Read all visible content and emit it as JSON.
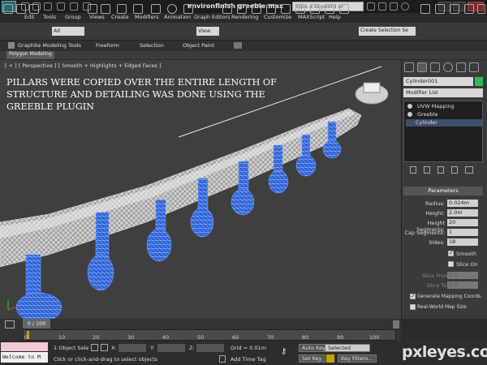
{
  "window": {
    "title": "environfinish greeble.max",
    "search_placeholder": "Type a keyword or phrase"
  },
  "menubar": {
    "items": [
      "Edit",
      "Tools",
      "Group",
      "Views",
      "Create",
      "Modifiers",
      "Animation",
      "Graph Editors",
      "Rendering",
      "Customize",
      "MAXScript",
      "Help"
    ]
  },
  "toolbar": {
    "selection_filter": "All",
    "view_dropdown": "View",
    "named_selection": "Create Selection Se"
  },
  "ribbon": {
    "tabs": [
      "Graphite Modeling Tools",
      "Freeform",
      "Selection",
      "Object Paint"
    ],
    "subtab": "Polygon Modeling"
  },
  "viewport": {
    "label": "[ + ] [ Perspective ] [ Smooth + Highlights + Edged Faces ]",
    "annotation": "PILLARS WERE COPIED OVER THE ENTIRE LENGTH OF STRUCTURE AND DETAILING WAS DONE USING THE GREEBLE PLUGIN"
  },
  "command_panel": {
    "object_name": "Cylinder001",
    "object_color": "#2fbf4f",
    "modifier_list": "Modifier List",
    "stack": [
      "UVW Mapping",
      "Greeble",
      "Cylinder"
    ],
    "parameters_title": "Parameters",
    "params": [
      {
        "label": "Radius:",
        "value": "0.024m"
      },
      {
        "label": "Height:",
        "value": "2.0m"
      },
      {
        "label": "Height Segments:",
        "value": "20"
      },
      {
        "label": "Cap Segments:",
        "value": "1"
      },
      {
        "label": "Sides:",
        "value": "18"
      }
    ],
    "smooth_label": "Smooth",
    "slice_on_label": "Slice On",
    "slice_from_label": "Slice From:",
    "slice_from_value": "0.0",
    "slice_to_label": "Slice To:",
    "slice_to_value": "0.0",
    "gen_mapping_label": "Generate Mapping Coords.",
    "realworld_label": "Real-World Map Size"
  },
  "timeline": {
    "frame_display": "0 / 100",
    "ticks": [
      "0",
      "10",
      "20",
      "30",
      "40",
      "50",
      "60",
      "70",
      "80",
      "90",
      "100"
    ]
  },
  "status": {
    "listener": "Welcome to M",
    "selected": "1 Object Sele",
    "prompt": "Click or click-and-drag to select objects",
    "x_label": "X:",
    "y_label": "Y:",
    "z_label": "Z:",
    "grid": "Grid = 0.01m",
    "add_time_tag": "Add Time Tag",
    "auto_key": "Auto Key",
    "selected_dropdown": "Selected",
    "set_key": "Set Key",
    "key_filters": "Key Filters..."
  },
  "watermark": "pxleyes.com"
}
